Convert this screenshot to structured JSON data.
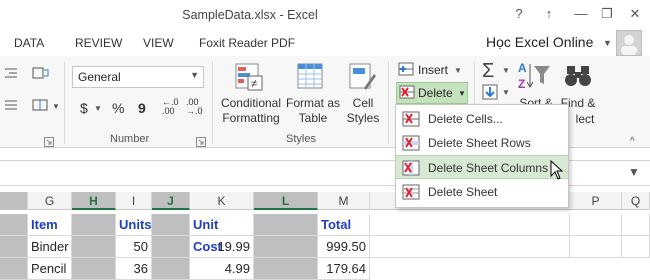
{
  "window": {
    "title": "SampleData.xlsx - Excel",
    "help": "?",
    "ribbon_display": "↑",
    "minimize": "—",
    "restore": "❐",
    "close": "✕"
  },
  "tabs": [
    {
      "label": "DATA"
    },
    {
      "label": "REVIEW"
    },
    {
      "label": "VIEW"
    },
    {
      "label": "Foxit Reader PDF"
    }
  ],
  "account": "Học Excel Online",
  "ribbon": {
    "number": {
      "format_value": "General",
      "currency": "$",
      "percent": "%",
      "comma": "9",
      "increase_decimal": "←.0 .00",
      "decrease_decimal": ".00 →.0",
      "group_label": "Number"
    },
    "styles": {
      "conditional_formatting": "Conditional Formatting",
      "format_as_table": "Format as Table",
      "cell_styles": "Cell Styles",
      "group_label": "Styles"
    },
    "cells": {
      "insert": "Insert",
      "delete": "Delete"
    },
    "editing": {
      "sort_filter": "Sort &",
      "find_select": "Find &",
      "select_partial": "lect"
    }
  },
  "delete_menu": {
    "items": [
      {
        "label": "Delete Cells...",
        "highlighted": false
      },
      {
        "label": "Delete Sheet Rows",
        "highlighted": false
      },
      {
        "label": "Delete Sheet Columns",
        "highlighted": true
      },
      {
        "label": "Delete Sheet",
        "highlighted": false
      }
    ]
  },
  "columns": [
    "G",
    "H",
    "I",
    "J",
    "K",
    "L",
    "M",
    "P",
    "Q"
  ],
  "table": {
    "headers": {
      "item": "Item",
      "units": "Units",
      "unit_cost": "Unit Cost",
      "total": "Total"
    },
    "rows": [
      {
        "item": "Binder",
        "units": "50",
        "unit_cost": "19.99",
        "total": "999.50"
      },
      {
        "item": "Pencil",
        "units": "36",
        "unit_cost": "4.99",
        "total": "179.64"
      }
    ]
  },
  "colors": {
    "accent_green": "#217346",
    "header_blue": "#1f3fbf",
    "selection_grey": "#bfbfbf",
    "menu_highlight": "#d7e9d3"
  }
}
